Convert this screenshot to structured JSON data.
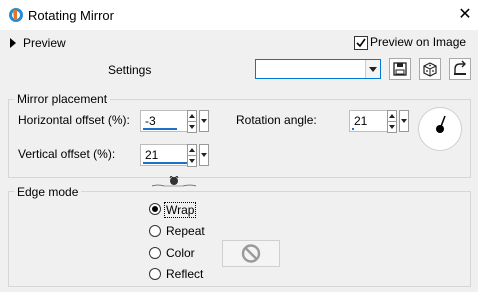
{
  "window": {
    "title": "Rotating Mirror",
    "close_glyph": "✕"
  },
  "preview": {
    "label": "Preview",
    "preview_on_image_label": "Preview on Image",
    "preview_on_image_checked": true
  },
  "settings": {
    "label": "Settings",
    "value": "",
    "toolbar_icons": [
      "save-icon",
      "randomize-dice-icon",
      "reset-icon"
    ]
  },
  "mirror_placement": {
    "title": "Mirror placement",
    "horizontal_offset": {
      "label": "Horizontal offset (%):",
      "value": "-3"
    },
    "vertical_offset": {
      "label": "Vertical offset (%):",
      "value": "21"
    },
    "rotation_angle": {
      "label": "Rotation angle:",
      "value": "21"
    }
  },
  "edge_mode": {
    "title": "Edge mode",
    "options": [
      {
        "label": "Wrap",
        "selected": true
      },
      {
        "label": "Repeat",
        "selected": false
      },
      {
        "label": "Color",
        "selected": false
      },
      {
        "label": "Reflect",
        "selected": false
      }
    ],
    "color_swatch_icon": "no-color-icon"
  },
  "colors": {
    "accent": "#0078d7",
    "value_bar": "#1e6fc8",
    "background": "#f0f0f0"
  }
}
